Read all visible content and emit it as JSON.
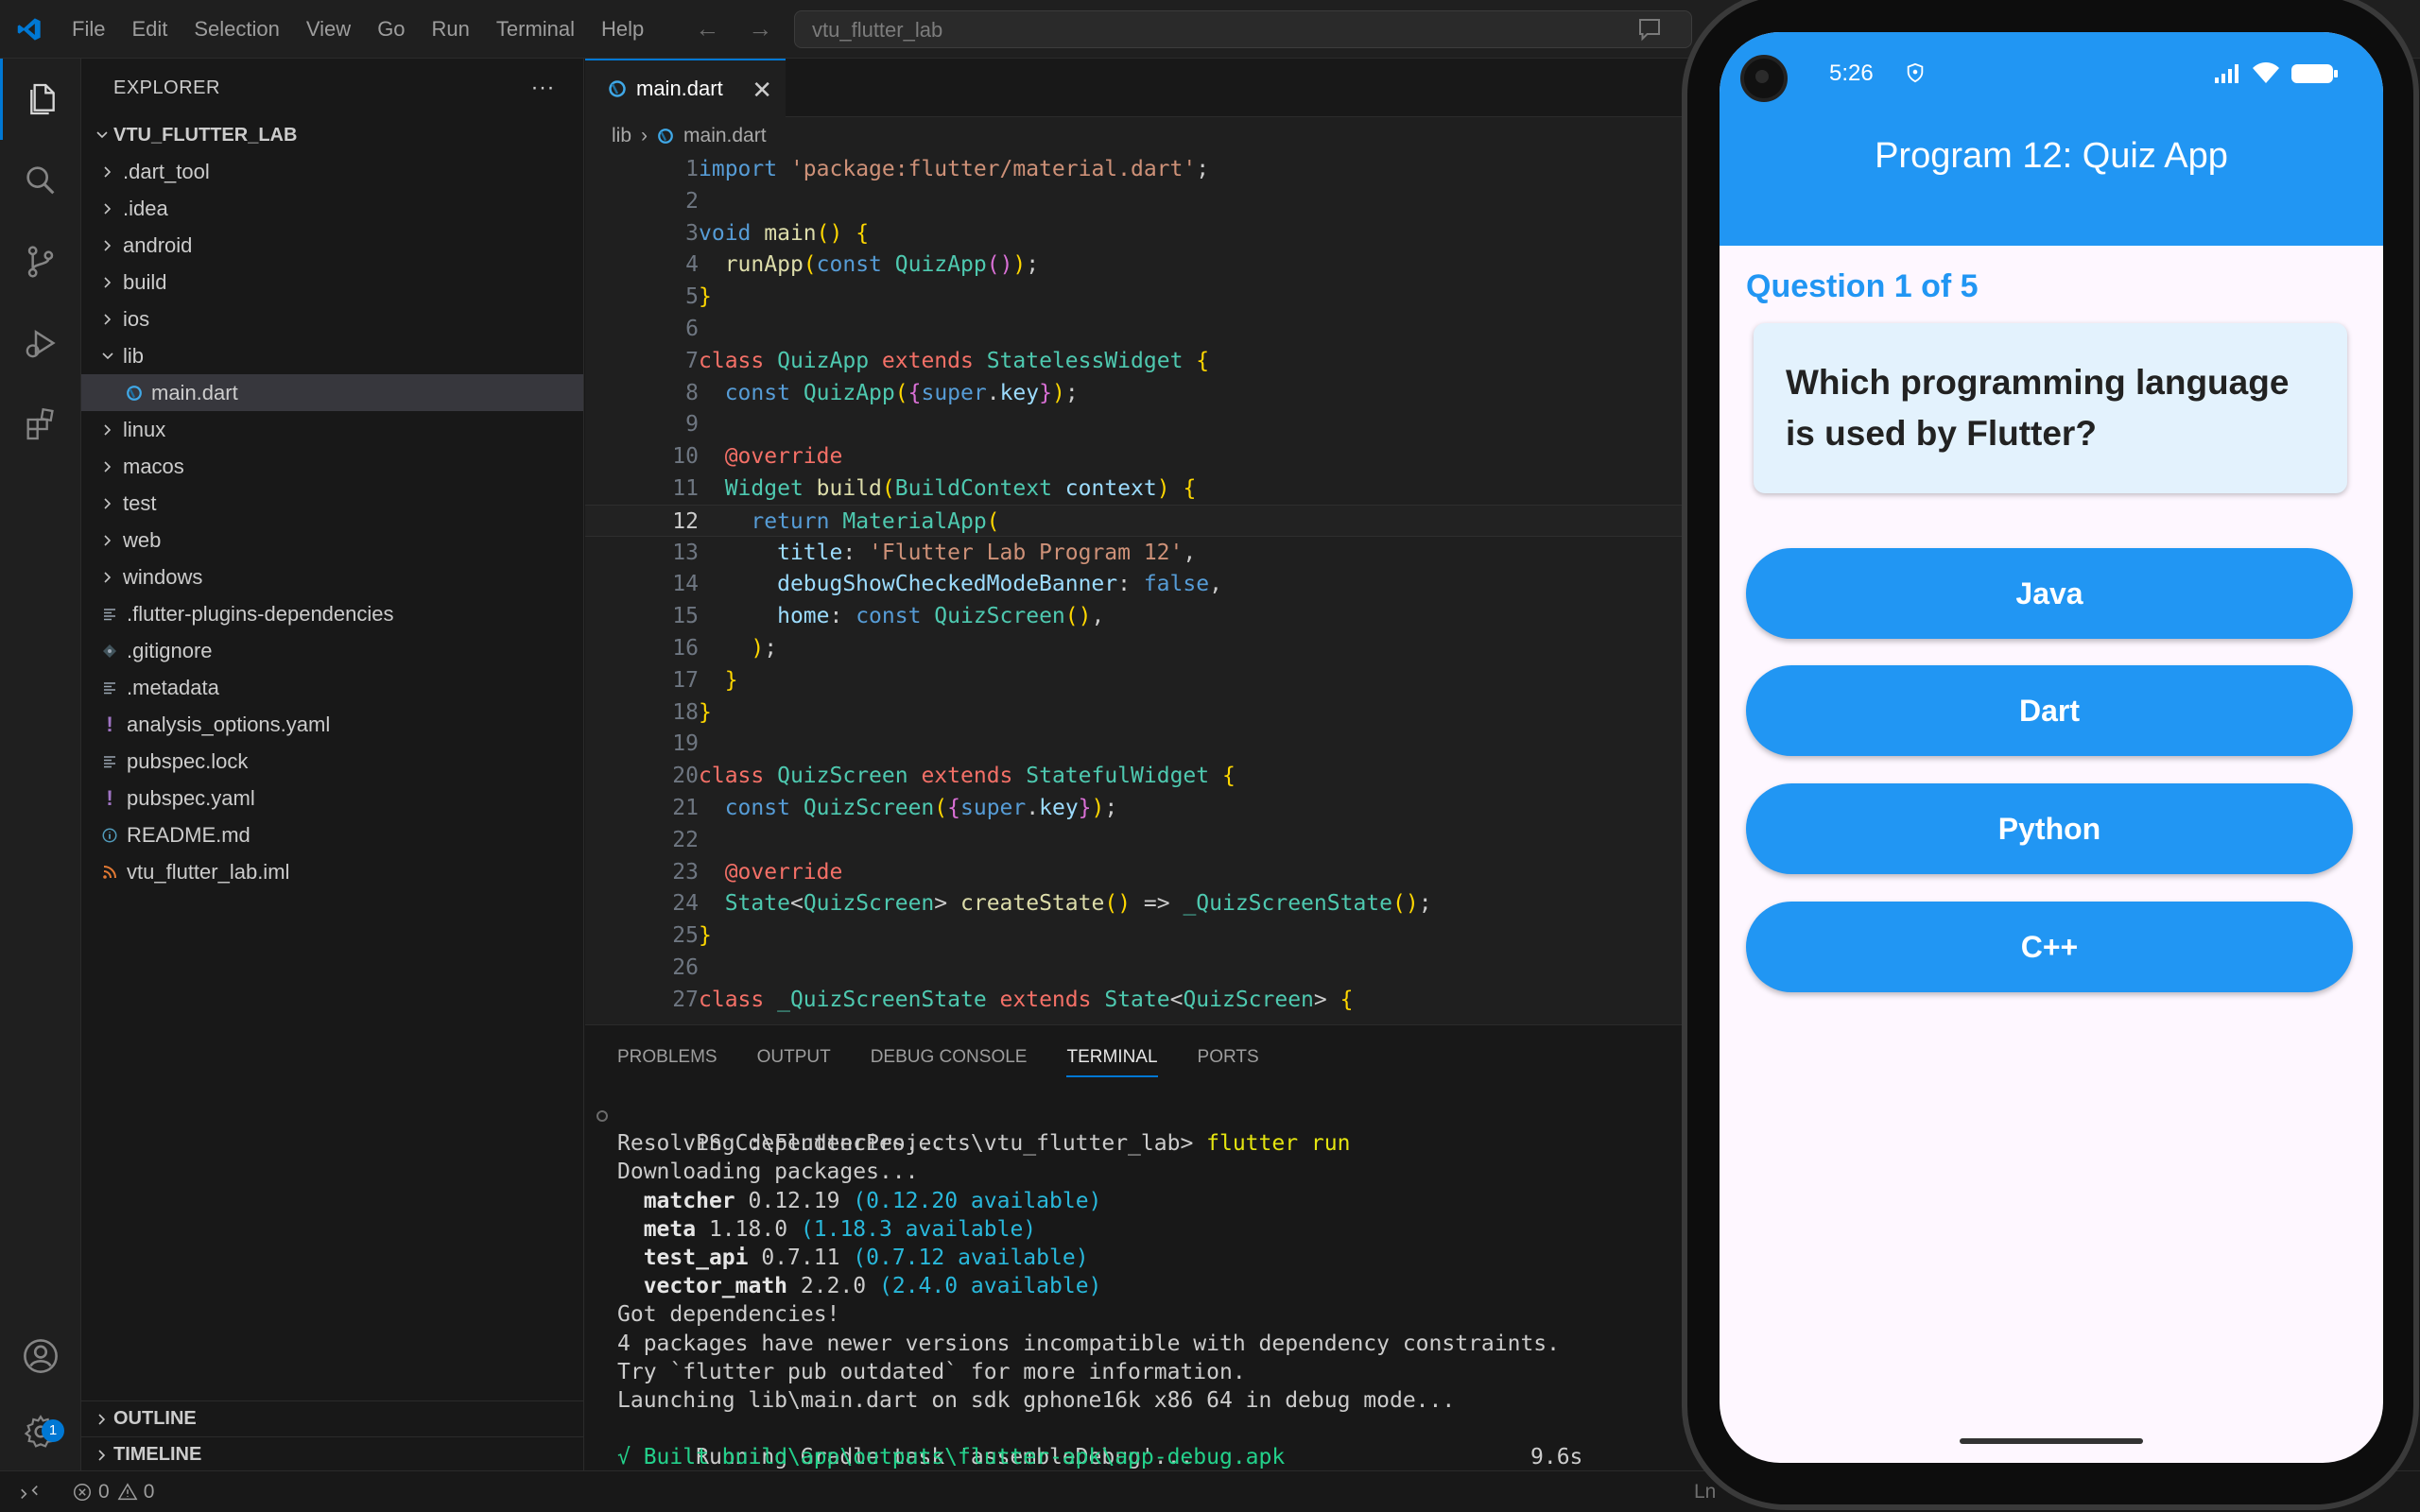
{
  "titlebar": {
    "menu": [
      "File",
      "Edit",
      "Selection",
      "View",
      "Go",
      "Run",
      "Terminal",
      "Help"
    ],
    "search_text": "vtu_flutter_lab"
  },
  "explorer": {
    "header": "EXPLORER",
    "project": "VTU_FLUTTER_LAB",
    "items": [
      {
        "label": ".dart_tool",
        "type": "folder",
        "open": false,
        "icon": "chevron-right-icon"
      },
      {
        "label": ".idea",
        "type": "folder",
        "open": false,
        "icon": "chevron-right-icon"
      },
      {
        "label": "android",
        "type": "folder",
        "open": false,
        "icon": "chevron-right-icon"
      },
      {
        "label": "build",
        "type": "folder",
        "open": false,
        "icon": "chevron-right-icon"
      },
      {
        "label": "ios",
        "type": "folder",
        "open": false,
        "icon": "chevron-right-icon"
      },
      {
        "label": "lib",
        "type": "folder",
        "open": true,
        "icon": "chevron-down-icon"
      },
      {
        "label": "main.dart",
        "type": "dart",
        "selected": true,
        "icon": "dart-icon"
      },
      {
        "label": "linux",
        "type": "folder",
        "open": false,
        "icon": "chevron-right-icon"
      },
      {
        "label": "macos",
        "type": "folder",
        "open": false,
        "icon": "chevron-right-icon"
      },
      {
        "label": "test",
        "type": "folder",
        "open": false,
        "icon": "chevron-right-icon"
      },
      {
        "label": "web",
        "type": "folder",
        "open": false,
        "icon": "chevron-right-icon"
      },
      {
        "label": "windows",
        "type": "folder",
        "open": false,
        "icon": "chevron-right-icon"
      },
      {
        "label": ".flutter-plugins-dependencies",
        "type": "file",
        "icon": "lines-icon"
      },
      {
        "label": ".gitignore",
        "type": "file",
        "icon": "git-icon"
      },
      {
        "label": ".metadata",
        "type": "file",
        "icon": "lines-icon"
      },
      {
        "label": "analysis_options.yaml",
        "type": "yaml",
        "icon": "exclamation-icon"
      },
      {
        "label": "pubspec.lock",
        "type": "file",
        "icon": "lines-icon"
      },
      {
        "label": "pubspec.yaml",
        "type": "yaml",
        "icon": "exclamation-icon"
      },
      {
        "label": "README.md",
        "type": "info",
        "icon": "info-icon"
      },
      {
        "label": "vtu_flutter_lab.iml",
        "type": "rss",
        "icon": "rss-icon"
      }
    ],
    "outline": "OUTLINE",
    "timeline": "TIMELINE"
  },
  "editor": {
    "tab": "main.dart",
    "breadcrumb": [
      "lib",
      "main.dart"
    ],
    "current_line": 12,
    "lines": [
      {
        "n": "1",
        "t": "import 'package:flutter/material.dart';"
      },
      {
        "n": "2",
        "t": ""
      },
      {
        "n": "3",
        "t": "void main() {"
      },
      {
        "n": "4",
        "t": "  runApp(const QuizApp());"
      },
      {
        "n": "5",
        "t": "}"
      },
      {
        "n": "6",
        "t": ""
      },
      {
        "n": "7",
        "t": "class QuizApp extends StatelessWidget {"
      },
      {
        "n": "8",
        "t": "  const QuizApp({super.key});"
      },
      {
        "n": "9",
        "t": ""
      },
      {
        "n": "10",
        "t": "  @override"
      },
      {
        "n": "11",
        "t": "  Widget build(BuildContext context) {"
      },
      {
        "n": "12",
        "t": "    return MaterialApp("
      },
      {
        "n": "13",
        "t": "      title: 'Flutter Lab Program 12',"
      },
      {
        "n": "14",
        "t": "      debugShowCheckedModeBanner: false,"
      },
      {
        "n": "15",
        "t": "      home: const QuizScreen(),"
      },
      {
        "n": "16",
        "t": "    );"
      },
      {
        "n": "17",
        "t": "  }"
      },
      {
        "n": "18",
        "t": "}"
      },
      {
        "n": "19",
        "t": ""
      },
      {
        "n": "20",
        "t": "class QuizScreen extends StatefulWidget {"
      },
      {
        "n": "21",
        "t": "  const QuizScreen({super.key});"
      },
      {
        "n": "22",
        "t": ""
      },
      {
        "n": "23",
        "t": "  @override"
      },
      {
        "n": "24",
        "t": "  State<QuizScreen> createState() => _QuizScreenState();"
      },
      {
        "n": "25",
        "t": "}"
      },
      {
        "n": "26",
        "t": ""
      },
      {
        "n": "27",
        "t": "class _QuizScreenState extends State<QuizScreen> {"
      }
    ]
  },
  "panel": {
    "tabs": [
      "PROBLEMS",
      "OUTPUT",
      "DEBUG CONSOLE",
      "TERMINAL",
      "PORTS"
    ],
    "active_tab": "TERMINAL",
    "terminal": {
      "prompt": "PS C:\\FlutterProjects\\vtu_flutter_lab> ",
      "command": "flutter run",
      "resolving": "Resolving dependencies...",
      "downloading": "Downloading packages...",
      "packages": [
        {
          "name": "matcher",
          "version": "0.12.19",
          "available": "(0.12.20 available)"
        },
        {
          "name": "meta",
          "version": "1.18.0",
          "available": "(1.18.3 available)"
        },
        {
          "name": "test_api",
          "version": "0.7.11",
          "available": "(0.7.12 available)"
        },
        {
          "name": "vector_math",
          "version": "2.2.0",
          "available": "(2.4.0 available)"
        }
      ],
      "got": "Got dependencies!",
      "incompatible": "4 packages have newer versions incompatible with dependency constraints.",
      "try": "Try `flutter pub outdated` for more information.",
      "launching": "Launching lib\\main.dart on sdk gphone16k x86 64 in debug mode...",
      "gradle": "Running Gradle task 'assembleDebug'...",
      "gradle_time": "9.6s",
      "built": "√ Built build\\app\\outputs\\flutter-apk\\app-debug.apk"
    }
  },
  "statusbar": {
    "errors": "0",
    "warnings": "0",
    "right_text": "Ln"
  },
  "settings_badge": "1",
  "phone": {
    "time": "5:26",
    "appbar_title": "Program 12: Quiz App",
    "question_counter": "Question 1 of 5",
    "question": "Which programming language is used by Flutter?",
    "options": [
      "Java",
      "Dart",
      "Python",
      "C++"
    ]
  },
  "colors": {
    "accent": "#0078d4",
    "flutter_blue": "#2196f3",
    "card_bg": "#e3f2fd"
  }
}
